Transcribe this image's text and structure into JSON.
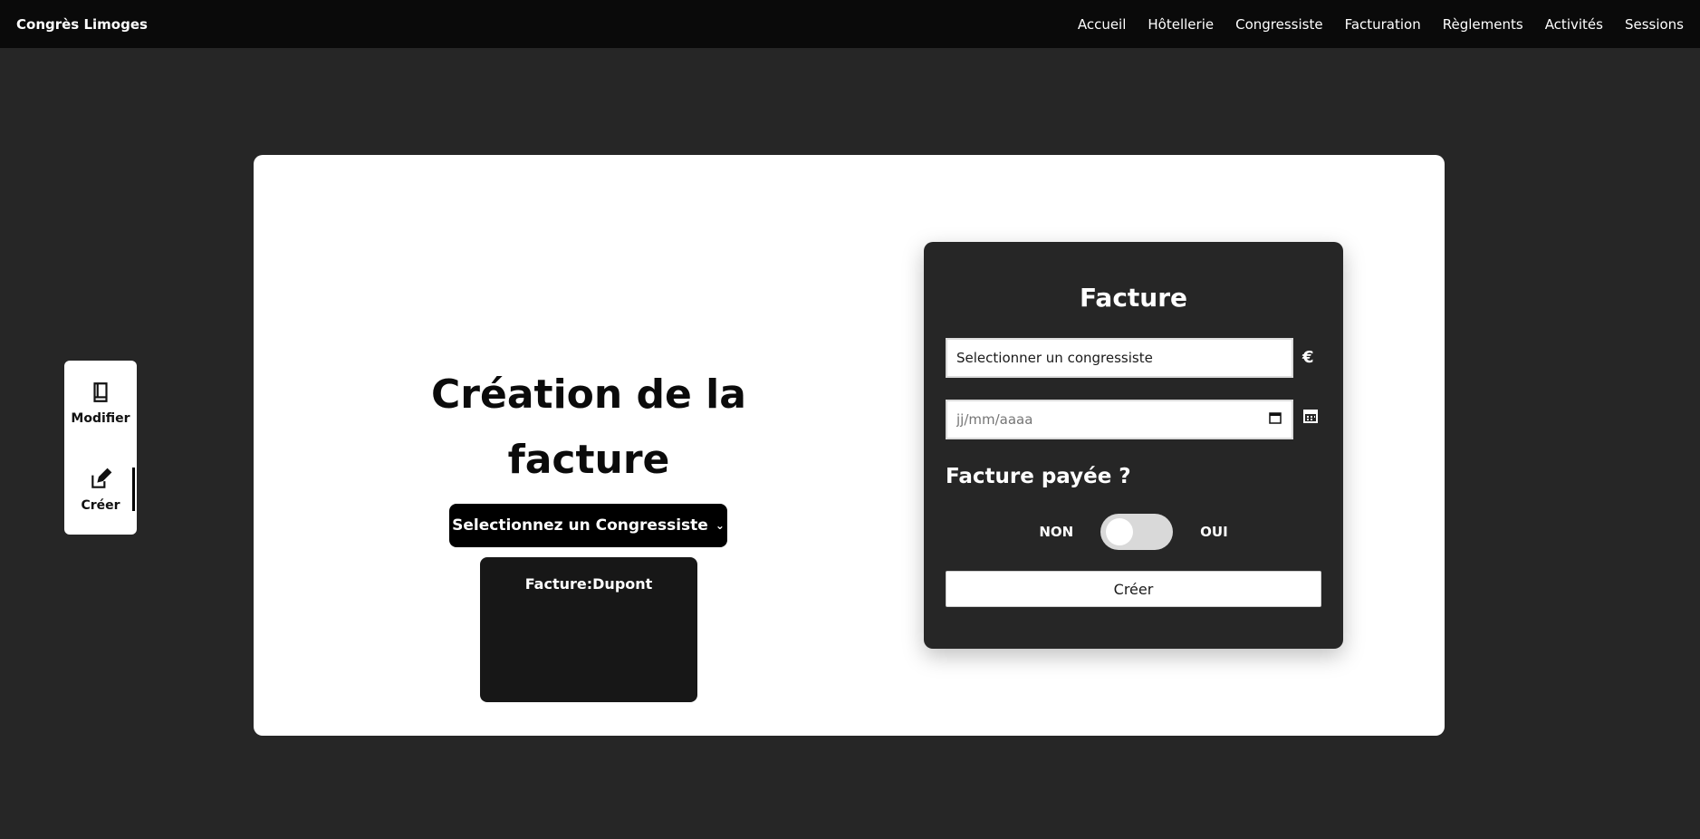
{
  "app": {
    "brand": "Congrès Limoges"
  },
  "nav": {
    "items": [
      "Accueil",
      "Hôtellerie",
      "Congressiste",
      "Facturation",
      "Règlements",
      "Activités",
      "Sessions"
    ]
  },
  "sidemenu": {
    "items": [
      {
        "label": "Modifier",
        "icon": "book-icon"
      },
      {
        "label": "Créer",
        "icon": "edit-icon"
      }
    ]
  },
  "main": {
    "title_line1": "Création de la",
    "title_line2": "facture",
    "select_label": "Selectionnez un Congressiste",
    "preview_title": "Facture:Dupont"
  },
  "form": {
    "title": "Facture",
    "contact_value": "Selectionner un congressiste",
    "date_placeholder": "jj/mm/aaaa",
    "currency_symbol": "€",
    "paid_question": "Facture payée ?",
    "toggle_off": "NON",
    "toggle_on": "OUI",
    "submit_label": "Créer"
  },
  "colors": {
    "background": "#262626",
    "topbar": "#0a0a0a",
    "card": "#ffffff"
  }
}
